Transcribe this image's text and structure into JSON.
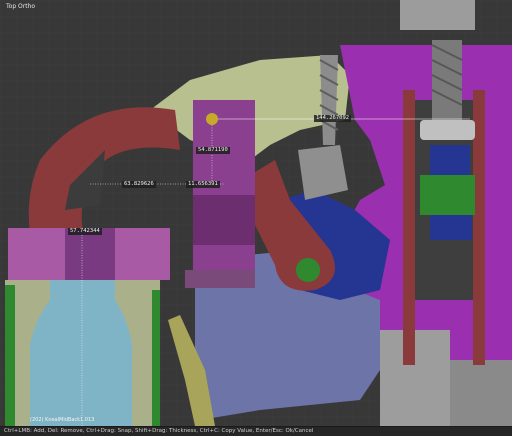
{
  "viewport": {
    "header_label": "Top Ortho",
    "object_name": "(202) KnealMidBack1.013"
  },
  "measurements": [
    {
      "id": "m1",
      "value": "144.267092"
    },
    {
      "id": "m2",
      "value": "54.871190"
    },
    {
      "id": "m3",
      "value": "63.829626"
    },
    {
      "id": "m4",
      "value": "11.656391"
    },
    {
      "id": "m5",
      "value": "57.742344"
    }
  ],
  "statusbar": {
    "text": "Ctrl+LMB: Add, Del: Remove, Ctrl+Drag: Snap, Shift+Drag: Thickness, Ctrl+C: Copy Value, Enter/Esc: Ok/Cancel"
  },
  "colors": {
    "grid": "#3d3d3d",
    "purple": "#9a2fb0",
    "maroon": "#8a3a3a",
    "olive": "#b9c08f",
    "blue": "#6d74a8",
    "navy": "#243592",
    "green": "#2f8a2f",
    "cyan": "#7fb4c6"
  }
}
